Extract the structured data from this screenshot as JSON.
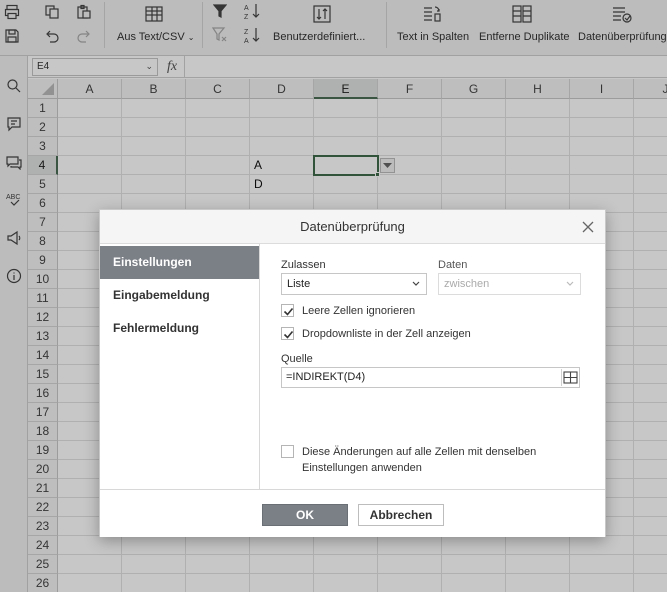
{
  "ribbon": {
    "import_label": "Aus Text/CSV",
    "custom_sort_label": "Benutzerdefiniert...",
    "text_to_columns_label": "Text in Spalten",
    "remove_duplicates_label": "Entferne Duplikate",
    "data_validation_label": "Datenüberprüfung"
  },
  "formula_bar": {
    "name_box": "E4",
    "fx_label": "fx",
    "formula": ""
  },
  "grid": {
    "columns": [
      "A",
      "B",
      "C",
      "D",
      "E",
      "F",
      "G",
      "H",
      "I",
      "J"
    ],
    "rows": [
      "1",
      "2",
      "3",
      "4",
      "5",
      "6",
      "7",
      "8",
      "9",
      "10",
      "11",
      "12",
      "13",
      "14",
      "15",
      "16",
      "17",
      "18",
      "19",
      "20",
      "21",
      "22",
      "23",
      "24",
      "25",
      "26"
    ],
    "selected_cell": "E4",
    "cells": {
      "D4": "A",
      "D5": "D"
    }
  },
  "dialog": {
    "title": "Datenüberprüfung",
    "nav": [
      "Einstellungen",
      "Eingabemeldung",
      "Fehlermeldung"
    ],
    "active_nav": "Einstellungen",
    "allow_label": "Zulassen",
    "allow_value": "Liste",
    "data_label": "Daten",
    "data_value": "zwischen",
    "ignore_blank_label": "Leere Zellen ignorieren",
    "ignore_blank_checked": true,
    "dropdown_label": "Dropdownliste in der Zell anzeigen",
    "dropdown_checked": true,
    "source_label": "Quelle",
    "source_value": "=INDIREKT(D4)",
    "apply_all_line1": "Diese Änderungen auf alle Zellen mit denselben",
    "apply_all_line2": "Einstellungen anwenden",
    "apply_all_checked": false,
    "ok_label": "OK",
    "cancel_label": "Abbrechen"
  },
  "colors": {
    "accent_green": "#3e6b49",
    "nav_active": "#7b7f86",
    "overlay": "rgba(0,0,0,0.22)"
  }
}
